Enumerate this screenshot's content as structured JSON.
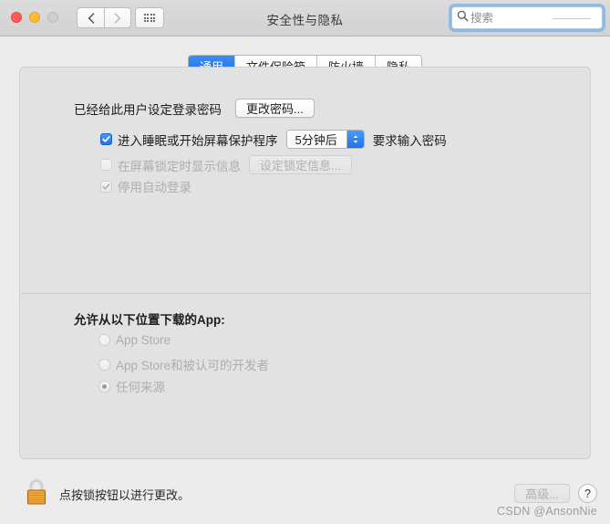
{
  "window": {
    "title": "安全性与隐私",
    "traffic_lights": [
      "close",
      "minimize",
      "zoom"
    ],
    "nav": {
      "back": "back-arrow",
      "forward": "forward-arrow",
      "show_all": "grid-icon"
    },
    "search": {
      "placeholder": "搜索",
      "value": "",
      "icon": "search-icon"
    }
  },
  "tabs": [
    {
      "label": "通用",
      "active": true
    },
    {
      "label": "文件保险箱",
      "active": false
    },
    {
      "label": "防火墙",
      "active": false
    },
    {
      "label": "隐私",
      "active": false
    }
  ],
  "general": {
    "password_label": "已经给此用户设定登录密码",
    "change_password_button": "更改密码...",
    "require_password": {
      "checked": true,
      "enabled": true,
      "prefix_label": "进入睡眠或开始屏幕保护程序",
      "delay_value": "5分钟后",
      "suffix_label": "要求输入密码"
    },
    "lock_message": {
      "checked": false,
      "enabled": false,
      "label": "在屏幕锁定时显示信息",
      "button": "设定锁定信息..."
    },
    "disable_auto_login": {
      "checked": true,
      "enabled": false,
      "label": "停用自动登录"
    }
  },
  "app_download": {
    "heading": "允许从以下位置下载的App:",
    "options": [
      {
        "label": "App Store",
        "selected": false,
        "enabled": false
      },
      {
        "label": "App Store和被认可的开发者",
        "selected": false,
        "enabled": false
      },
      {
        "label": "任何来源",
        "selected": true,
        "enabled": false
      }
    ]
  },
  "footer": {
    "lock_icon": "lock-closed-icon",
    "lock_note": "点按锁按钮以进行更改。",
    "advanced_button": "高级...",
    "help_button": "?",
    "watermark": "CSDN @AnsonNie"
  },
  "colors": {
    "accent": "#1f73e8",
    "toolbar": "#d6d6d6",
    "body": "#ececec",
    "panel": "#e2e2e2",
    "lock_body": "#f0a836"
  }
}
